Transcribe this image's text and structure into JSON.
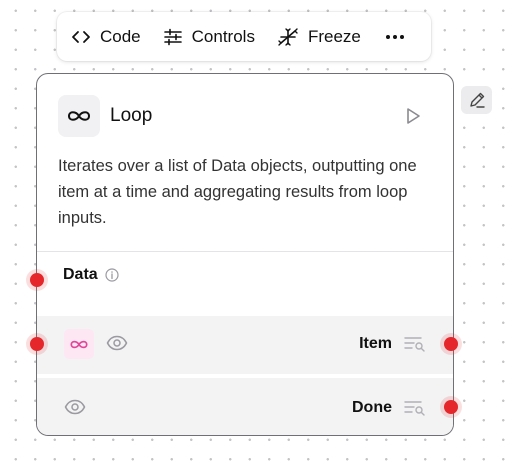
{
  "toolbar": {
    "code_label": "Code",
    "controls_label": "Controls",
    "freeze_label": "Freeze"
  },
  "node": {
    "title": "Loop",
    "icon": "infinity-icon",
    "description": "Iterates over a list of Data objects, outputting one item at a time and aggregating results from loop inputs.",
    "inputs": [
      {
        "label": "Data",
        "icon": "info-icon"
      }
    ],
    "outputs": [
      {
        "label": "Item",
        "badge_icon": "infinity-icon"
      },
      {
        "label": "Done"
      }
    ]
  },
  "colors": {
    "handle": "#e5262b",
    "loop_badge_bg": "#fde7f3",
    "loop_badge_fg": "#e0479b",
    "node_border": "#6f6f75"
  }
}
